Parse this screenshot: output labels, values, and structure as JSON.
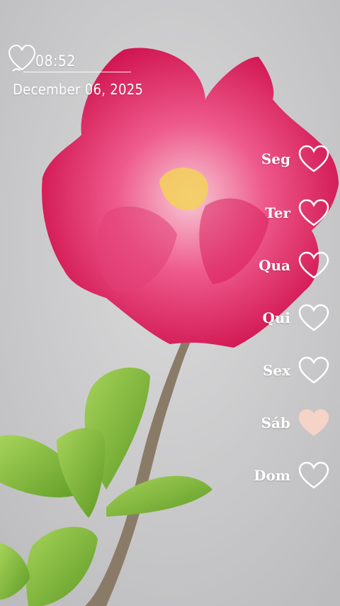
{
  "clock": {
    "time": "08:52",
    "date": "December 06, 2025"
  },
  "week": [
    {
      "label": "Seg",
      "filled": false
    },
    {
      "label": "Ter",
      "filled": false
    },
    {
      "label": "Qua",
      "filled": false
    },
    {
      "label": "Qui",
      "filled": false
    },
    {
      "label": "Sex",
      "filled": false
    },
    {
      "label": "Sáb",
      "filled": true
    },
    {
      "label": "Dom",
      "filled": false
    }
  ],
  "colors": {
    "heart_fill": "#f5d3c6",
    "heart_outline": "#ffffff",
    "petal": "#e0195c",
    "leaf": "#86bf3c",
    "wall": "#cfcfd0"
  },
  "icons": {
    "clock": "heart-outline-icon",
    "day": "heart-icon"
  }
}
